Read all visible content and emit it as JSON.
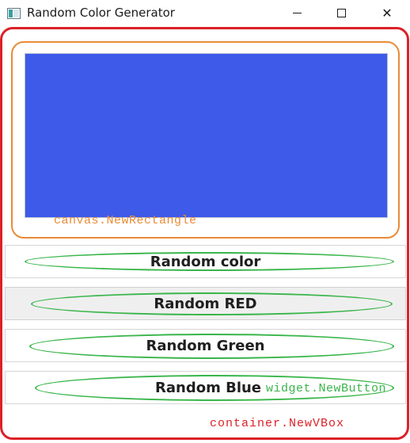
{
  "window": {
    "title": "Random Color Generator",
    "controls": {
      "minimize_icon": "minimize-icon",
      "maximize_icon": "maximize-icon",
      "close_icon": "close-icon",
      "close_glyph": "✕"
    }
  },
  "canvas": {
    "rect_color": "#3d5ae9",
    "annotation": "canvas.NewRectangle",
    "annotation_color": "#e98b36"
  },
  "buttons": [
    {
      "label": "Random color"
    },
    {
      "label": "Random RED"
    },
    {
      "label": "Random Green"
    },
    {
      "label": "Random Blue"
    }
  ],
  "annotations": {
    "widget": "widget.NewButton",
    "widget_color": "#39b54a",
    "container": "container.NewVBox",
    "container_color": "#dc2127"
  }
}
